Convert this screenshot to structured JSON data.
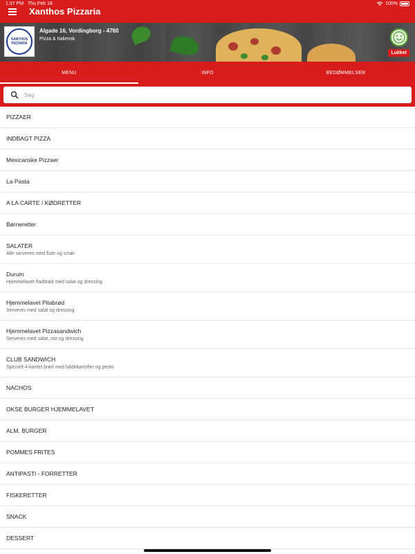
{
  "status_bar": {
    "time": "1:37 PM",
    "date": "Thu Feb 18",
    "battery": "100%"
  },
  "app": {
    "title": "Xanthos Pizzaria"
  },
  "restaurant": {
    "logo_text": "XANTHOS PIZZARIA",
    "address": "Algade 16, Vordingborg - 4760",
    "cuisine": "Pizza & Italiensk",
    "status_label": "Lukket"
  },
  "tabs": [
    {
      "label": "MENU",
      "active": true
    },
    {
      "label": "INFO",
      "active": false
    },
    {
      "label": "BEDØMMELSER",
      "active": false
    }
  ],
  "search": {
    "placeholder": "Søg"
  },
  "categories": [
    {
      "title": "PIZZAER",
      "subtitle": ""
    },
    {
      "title": "INDBAGT PIZZA",
      "subtitle": ""
    },
    {
      "title": "Mexicanske Pizzaer",
      "subtitle": ""
    },
    {
      "title": "La Pasta",
      "subtitle": ""
    },
    {
      "title": "A LA CARTE / KØDRETTER",
      "subtitle": ""
    },
    {
      "title": "Børneretter",
      "subtitle": ""
    },
    {
      "title": "SALATER",
      "subtitle": "Alle serveres med flute og smør"
    },
    {
      "title": "Durum",
      "subtitle": "Hjemmelavet fladbrød med salat og dressing"
    },
    {
      "title": "Hjemmelavet Pitabrød",
      "subtitle": "Serveres med salat og dressing"
    },
    {
      "title": "Hjemmelavet Pizzasandwich",
      "subtitle": "Serveres med salat, ost og dressing"
    },
    {
      "title": "CLUB SANDWICH",
      "subtitle": "Specielt 4-kantet brød med bådekartofler og pesto"
    },
    {
      "title": "NACHOS",
      "subtitle": ""
    },
    {
      "title": "OKSE BURGER HJEMMELAVET",
      "subtitle": ""
    },
    {
      "title": "ALM. BURGER",
      "subtitle": ""
    },
    {
      "title": "POMMES FRITES",
      "subtitle": ""
    },
    {
      "title": "ANTIPASTI - FORRETTER",
      "subtitle": ""
    },
    {
      "title": "FISKERETTER",
      "subtitle": ""
    },
    {
      "title": "SNACK",
      "subtitle": ""
    },
    {
      "title": "DESSERT",
      "subtitle": ""
    }
  ],
  "colors": {
    "brand_red": "#d81c1c",
    "divider": "#e5e5e5"
  }
}
